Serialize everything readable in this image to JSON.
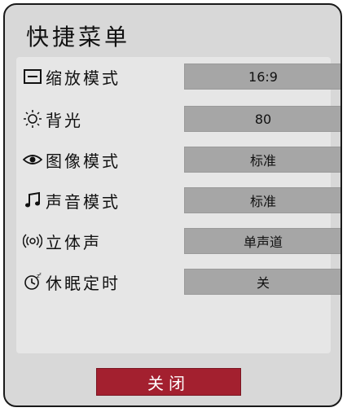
{
  "menu": {
    "title": "快捷菜单",
    "items": [
      {
        "label": "缩放模式",
        "value": "16:9",
        "icon": "aspect-ratio-icon"
      },
      {
        "label": "背光",
        "value": "80",
        "icon": "backlight-sun-icon"
      },
      {
        "label": "图像模式",
        "value": "标准",
        "icon": "eye-icon"
      },
      {
        "label": "声音模式",
        "value": "标准",
        "icon": "music-note-icon"
      },
      {
        "label": "立体声",
        "value": "单声道",
        "icon": "stereo-speaker-icon"
      },
      {
        "label": "休眠定时",
        "value": "关",
        "icon": "sleep-timer-icon"
      }
    ],
    "close_label": "关闭"
  },
  "colors": {
    "background": "#d8d8d8",
    "value_field": "#a6a6a6",
    "close_button": "#a3202f"
  }
}
